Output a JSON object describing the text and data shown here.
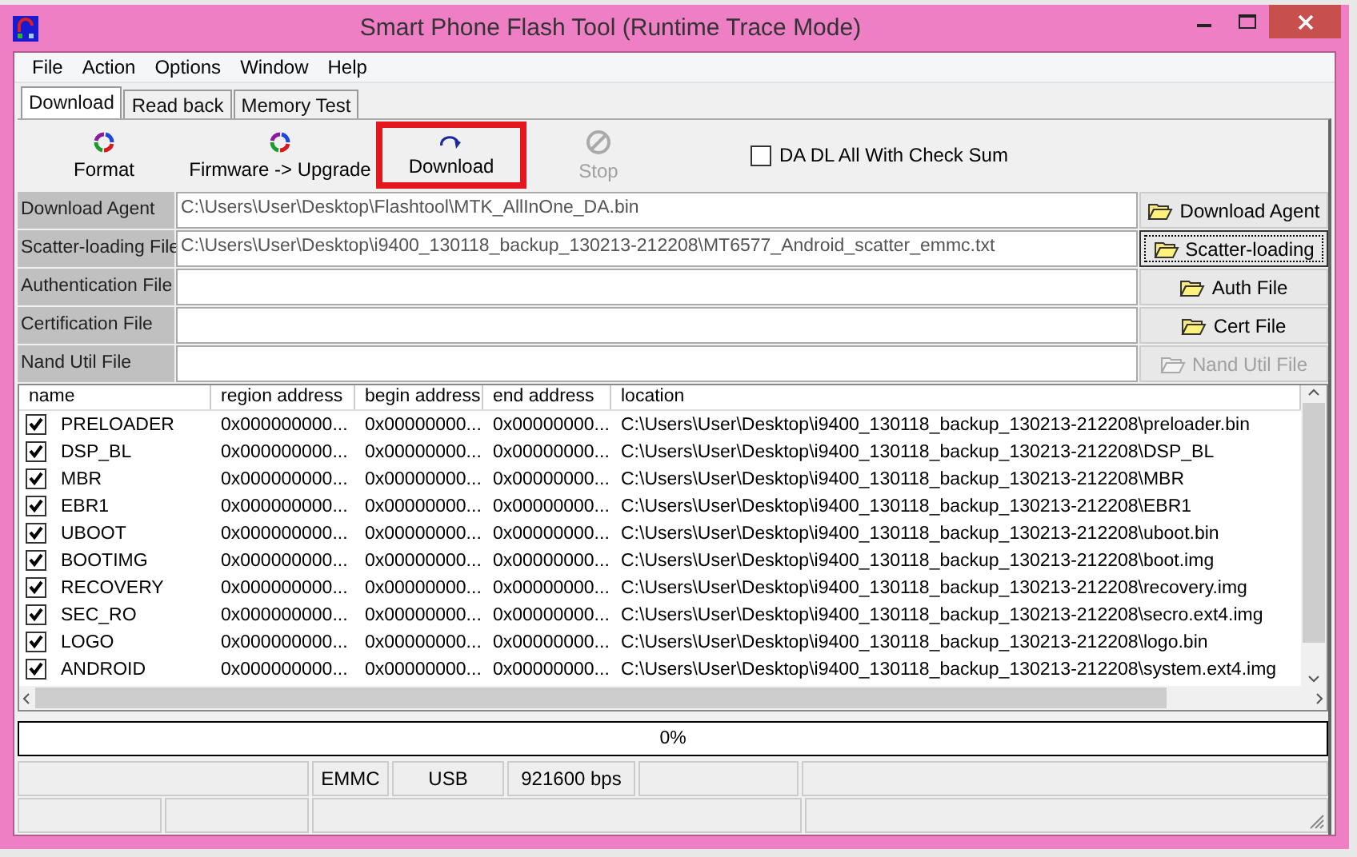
{
  "window": {
    "title": "Smart Phone Flash Tool (Runtime Trace Mode)"
  },
  "menu": [
    "File",
    "Action",
    "Options",
    "Window",
    "Help"
  ],
  "tabs": [
    {
      "label": "Download",
      "selected": true
    },
    {
      "label": "Read back",
      "selected": false
    },
    {
      "label": "Memory Test",
      "selected": false
    }
  ],
  "toolbar": [
    {
      "label": "Format",
      "kind": "format",
      "disabled": false,
      "highlighted": false
    },
    {
      "label": "Firmware -> Upgrade",
      "kind": "format",
      "disabled": false,
      "highlighted": false
    },
    {
      "label": "Download",
      "kind": "download",
      "disabled": false,
      "highlighted": true
    },
    {
      "label": "Stop",
      "kind": "stop",
      "disabled": true,
      "highlighted": false
    }
  ],
  "checksum_option": {
    "label": "DA DL All With Check Sum",
    "checked": false
  },
  "files": [
    {
      "label": "Download Agent",
      "value": "C:\\Users\\User\\Desktop\\Flashtool\\MTK_AllInOne_DA.bin",
      "button": "Download Agent",
      "disabled": false,
      "focused": false
    },
    {
      "label": "Scatter-loading File",
      "value": "C:\\Users\\User\\Desktop\\i9400_130118_backup_130213-212208\\MT6577_Android_scatter_emmc.txt",
      "button": "Scatter-loading",
      "disabled": false,
      "focused": true
    },
    {
      "label": "Authentication File",
      "button": "Auth File",
      "disabled": false,
      "focused": false
    },
    {
      "label": "Certification File",
      "button": "Cert File",
      "disabled": false,
      "focused": false
    },
    {
      "label": "Nand Util File",
      "button": "Nand Util File",
      "disabled": true,
      "focused": false
    }
  ],
  "table": {
    "columns": [
      "name",
      "region address",
      "begin address",
      "end address",
      "location"
    ],
    "rows": [
      {
        "checked": true,
        "name": "PRELOADER",
        "region": "0x000000000...",
        "begin": "0x00000000...",
        "end": "0x00000000...",
        "location": "C:\\Users\\User\\Desktop\\i9400_130118_backup_130213-212208\\preloader.bin"
      },
      {
        "checked": true,
        "name": "DSP_BL",
        "region": "0x000000000...",
        "begin": "0x00000000...",
        "end": "0x00000000...",
        "location": "C:\\Users\\User\\Desktop\\i9400_130118_backup_130213-212208\\DSP_BL"
      },
      {
        "checked": true,
        "name": "MBR",
        "region": "0x000000000...",
        "begin": "0x00000000...",
        "end": "0x00000000...",
        "location": "C:\\Users\\User\\Desktop\\i9400_130118_backup_130213-212208\\MBR"
      },
      {
        "checked": true,
        "name": "EBR1",
        "region": "0x000000000...",
        "begin": "0x00000000...",
        "end": "0x00000000...",
        "location": "C:\\Users\\User\\Desktop\\i9400_130118_backup_130213-212208\\EBR1"
      },
      {
        "checked": true,
        "name": "UBOOT",
        "region": "0x000000000...",
        "begin": "0x00000000...",
        "end": "0x00000000...",
        "location": "C:\\Users\\User\\Desktop\\i9400_130118_backup_130213-212208\\uboot.bin"
      },
      {
        "checked": true,
        "name": "BOOTIMG",
        "region": "0x000000000...",
        "begin": "0x00000000...",
        "end": "0x00000000...",
        "location": "C:\\Users\\User\\Desktop\\i9400_130118_backup_130213-212208\\boot.img"
      },
      {
        "checked": true,
        "name": "RECOVERY",
        "region": "0x000000000...",
        "begin": "0x00000000...",
        "end": "0x00000000...",
        "location": "C:\\Users\\User\\Desktop\\i9400_130118_backup_130213-212208\\recovery.img"
      },
      {
        "checked": true,
        "name": "SEC_RO",
        "region": "0x000000000...",
        "begin": "0x00000000...",
        "end": "0x00000000...",
        "location": "C:\\Users\\User\\Desktop\\i9400_130118_backup_130213-212208\\secro.ext4.img"
      },
      {
        "checked": true,
        "name": "LOGO",
        "region": "0x000000000...",
        "begin": "0x00000000...",
        "end": "0x00000000...",
        "location": "C:\\Users\\User\\Desktop\\i9400_130118_backup_130213-212208\\logo.bin"
      },
      {
        "checked": true,
        "name": "ANDROID",
        "region": "0x000000000...",
        "begin": "0x00000000...",
        "end": "0x00000000...",
        "location": "C:\\Users\\User\\Desktop\\i9400_130118_backup_130213-212208\\system.ext4.img"
      }
    ]
  },
  "progress": {
    "level": 0,
    "text": "0%"
  },
  "status_bar": {
    "storage": "EMMC",
    "port": "USB",
    "baud": "921600 bps"
  }
}
